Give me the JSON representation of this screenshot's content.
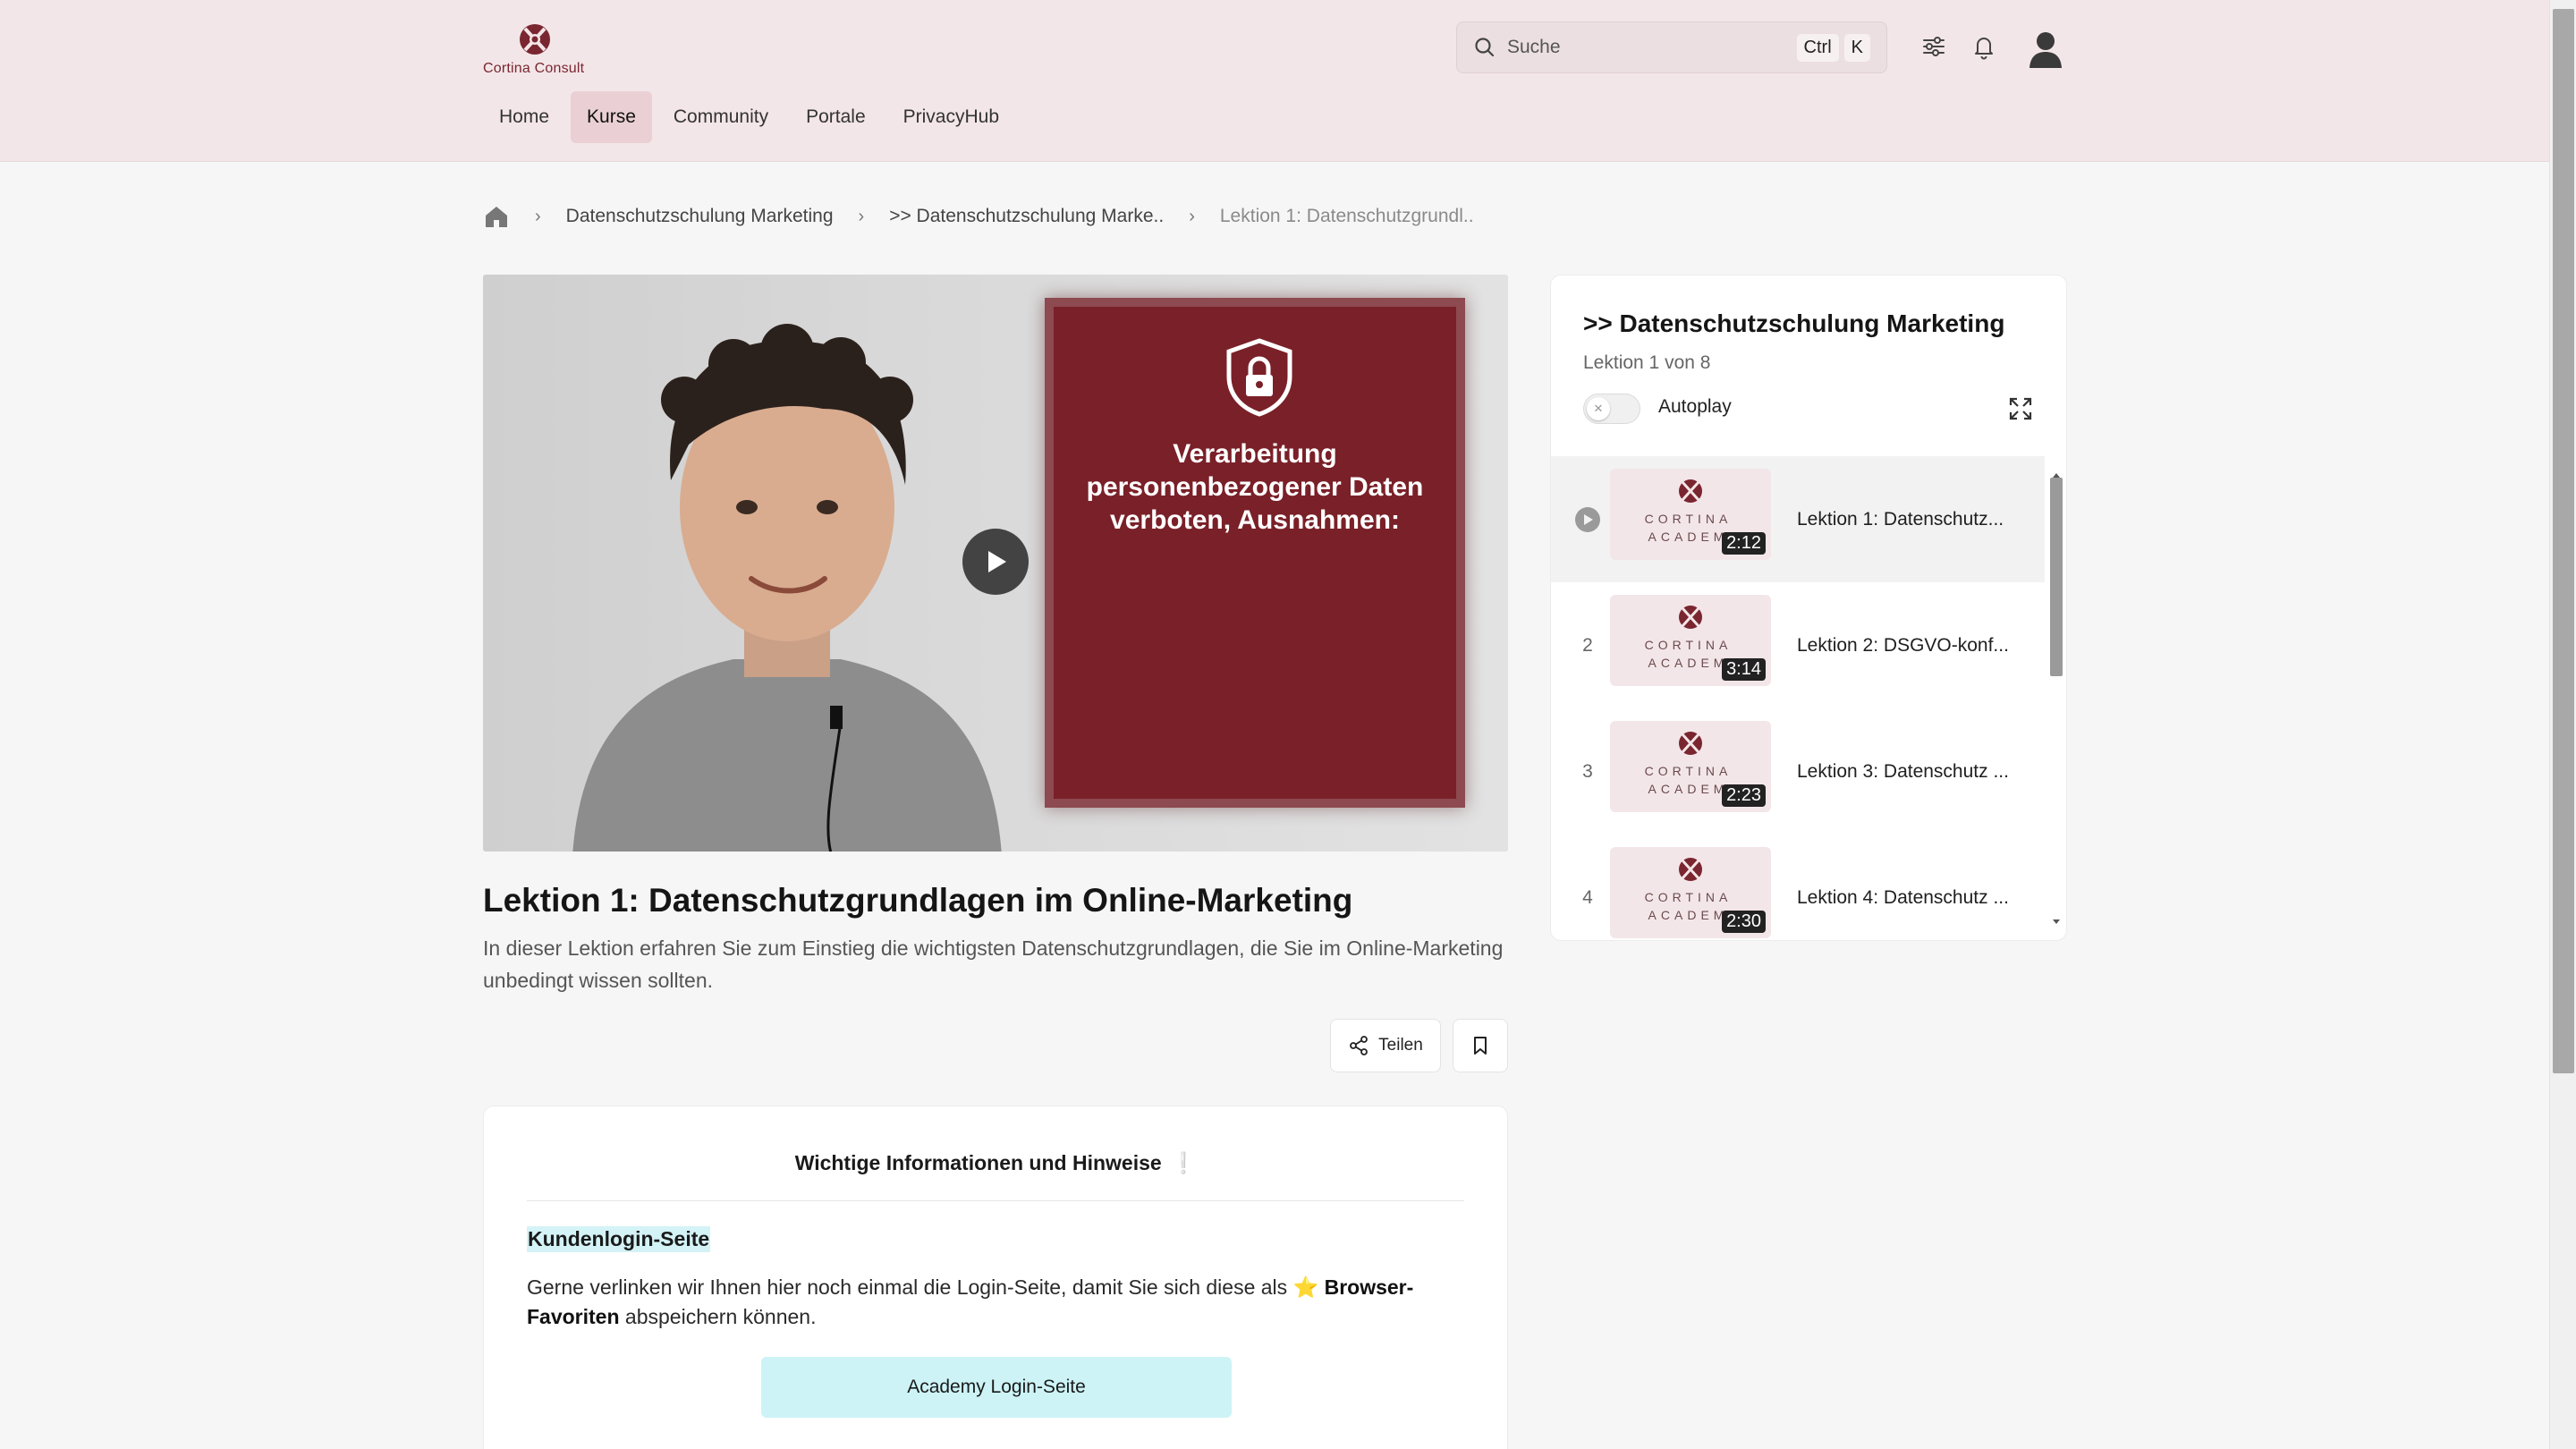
{
  "header": {
    "logo_text": "Cortina Consult",
    "nav": [
      {
        "label": "Home",
        "active": false
      },
      {
        "label": "Kurse",
        "active": true
      },
      {
        "label": "Community",
        "active": false
      },
      {
        "label": "Portale",
        "active": false
      },
      {
        "label": "PrivacyHub",
        "active": false
      }
    ],
    "search": {
      "placeholder": "Suche",
      "shortcut_ctrl": "Ctrl",
      "shortcut_key": "K"
    },
    "icons": [
      "sliders-icon",
      "bell-icon",
      "user-avatar-icon"
    ]
  },
  "breadcrumb": {
    "items": [
      "Datenschutzschulung Marketing",
      ">> Datenschutzschulung Marke..",
      "Lektion 1: Datenschutzgrundl.."
    ]
  },
  "video": {
    "slide_text": "Verarbeitung personenbezogener Daten verboten, Ausnahmen:"
  },
  "lesson": {
    "title": "Lektion 1: Datenschutzgrundlagen im Online-Marketing",
    "description": "In dieser Lektion erfahren Sie zum Einstieg die wichtigsten Datenschutzgrundlagen, die Sie im Online-Marketing unbedingt wissen sollten.",
    "share_label": "Teilen"
  },
  "info_card": {
    "heading": "Wichtige Informationen und Hinweise",
    "heading_mark": "❕",
    "subheading": "Kundenlogin-Seite",
    "text_before": "Gerne verlinken wir Ihnen hier noch einmal die Login-Seite, damit Sie sich diese als ",
    "star": "⭐",
    "text_bold": "Browser-Favoriten",
    "text_after": " abspeichern können.",
    "button_label": "Academy Login-Seite"
  },
  "playlist": {
    "title": ">> Datenschutzschulung Marketing",
    "subtitle": "Lektion 1 von 8",
    "autoplay_label": "Autoplay",
    "autoplay_on": false,
    "thumb_brand_1": "CORTINA",
    "thumb_brand_2": "ACADEM",
    "items": [
      {
        "num": "",
        "label": "Lektion 1: Datenschutz...",
        "time": "2:12",
        "active": true
      },
      {
        "num": "2",
        "label": "Lektion 2: DSGVO-konf...",
        "time": "3:14",
        "active": false
      },
      {
        "num": "3",
        "label": "Lektion 3: Datenschutz ...",
        "time": "2:23",
        "active": false
      },
      {
        "num": "4",
        "label": "Lektion 4: Datenschutz ...",
        "time": "2:30",
        "active": false
      }
    ]
  },
  "colors": {
    "header_bg": "#f3e6e8",
    "brand": "#7a2630",
    "accent_cyan": "#cdf3f6"
  }
}
